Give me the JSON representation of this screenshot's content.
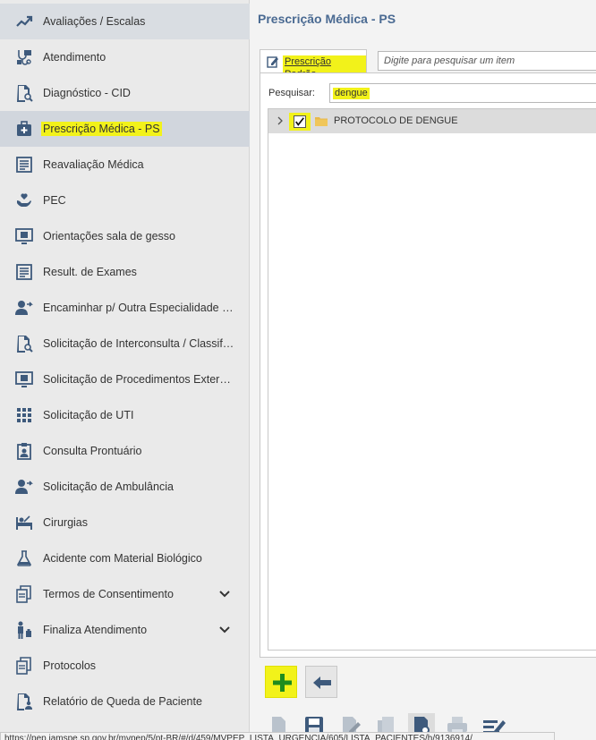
{
  "sidebar": {
    "items": [
      {
        "label": "Avaliações / Escalas",
        "icon": "trend-chart-icon"
      },
      {
        "label": "Atendimento",
        "icon": "stethoscope-icon"
      },
      {
        "label": "Diagnóstico - CID",
        "icon": "document-search-icon"
      },
      {
        "label": "Prescrição Médica - PS",
        "icon": "medical-bag-icon"
      },
      {
        "label": "Reavaliação Médica",
        "icon": "report-icon"
      },
      {
        "label": "PEC",
        "icon": "hand-heart-icon"
      },
      {
        "label": "Orientações sala de gesso",
        "icon": "monitor-doc-icon"
      },
      {
        "label": "Result. de Exames",
        "icon": "report-icon"
      },
      {
        "label": "Encaminhar p/ Outra Especialidade PS",
        "icon": "user-forward-icon"
      },
      {
        "label": "Solicitação de Interconsulta / Classific...",
        "icon": "document-search-icon"
      },
      {
        "label": "Solicitação de Procedimentos Externo...",
        "icon": "monitor-doc-icon"
      },
      {
        "label": "Solicitação de UTI",
        "icon": "grid-icon"
      },
      {
        "label": "Consulta Prontuário",
        "icon": "clipboard-user-icon"
      },
      {
        "label": "Solicitação de Ambulância",
        "icon": "user-forward-icon"
      },
      {
        "label": "Cirurgias",
        "icon": "surgery-bed-icon"
      },
      {
        "label": "Acidente com Material Biológico",
        "icon": "flask-icon"
      },
      {
        "label": "Termos de Consentimento",
        "icon": "documents-icon"
      },
      {
        "label": "Finaliza Atendimento",
        "icon": "person-walk-icon"
      },
      {
        "label": "Protocolos",
        "icon": "documents-icon"
      },
      {
        "label": "Relatório de Queda de Paciente",
        "icon": "doc-user-icon"
      }
    ]
  },
  "main": {
    "title": "Prescrição Médica - PS",
    "tab_label": "Prescrição Padrão",
    "item_search_placeholder": "Digite para pesquisar um item",
    "search_label": "Pesquisar:",
    "search_value": "dengue",
    "tree_items": [
      {
        "label": "PROTOCOLO DE DENGUE",
        "checked": true
      }
    ]
  },
  "status_bar": {
    "url": "https://pep.iamspe.sp.gov.br/mvpep/5/pt-BR/#/d/459/MVPEP_LISTA_URGENCIA/605/LISTA_PACIENTES/h/9136914/"
  },
  "colors": {
    "highlight": "#f2f21a",
    "title": "#4a6a92",
    "icon": "#3e5a7c",
    "add": "#1e8c1e"
  }
}
